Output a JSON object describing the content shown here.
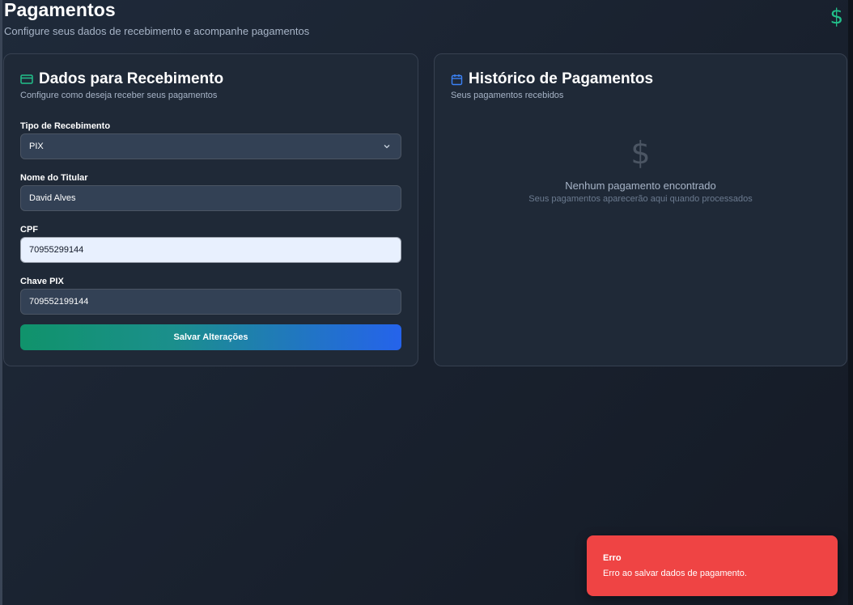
{
  "header": {
    "title": "Pagamentos",
    "subtitle": "Configure seus dados de recebimento e acompanhe pagamentos",
    "icon": "dollar-icon",
    "icon_color": "#22c08a"
  },
  "payment_form": {
    "title": "Dados para Recebimento",
    "description": "Configure como deseja receber seus pagamentos",
    "icon": "credit-card-icon",
    "fields": {
      "tipo": {
        "label": "Tipo de Recebimento",
        "value": "PIX"
      },
      "titular": {
        "label": "Nome do Titular",
        "value": "David Alves"
      },
      "cpf": {
        "label": "CPF",
        "value": "70955299144"
      },
      "chave_pix": {
        "label": "Chave PIX",
        "value": "709552199144"
      }
    },
    "save_label": "Salvar Alterações"
  },
  "history": {
    "title": "Histórico de Pagamentos",
    "description": "Seus pagamentos recebidos",
    "icon": "calendar-icon",
    "empty_icon": "dollar-icon",
    "empty_title": "Nenhum pagamento encontrado",
    "empty_subtitle": "Seus pagamentos aparecerão aqui quando processados"
  },
  "toast": {
    "title": "Erro",
    "message": "Erro ao salvar dados de pagamento.",
    "color": "#ef4444"
  },
  "colors": {
    "accent_green": "#22c08a",
    "accent_blue": "#3b82f6",
    "card_bg": "#1f2937"
  }
}
